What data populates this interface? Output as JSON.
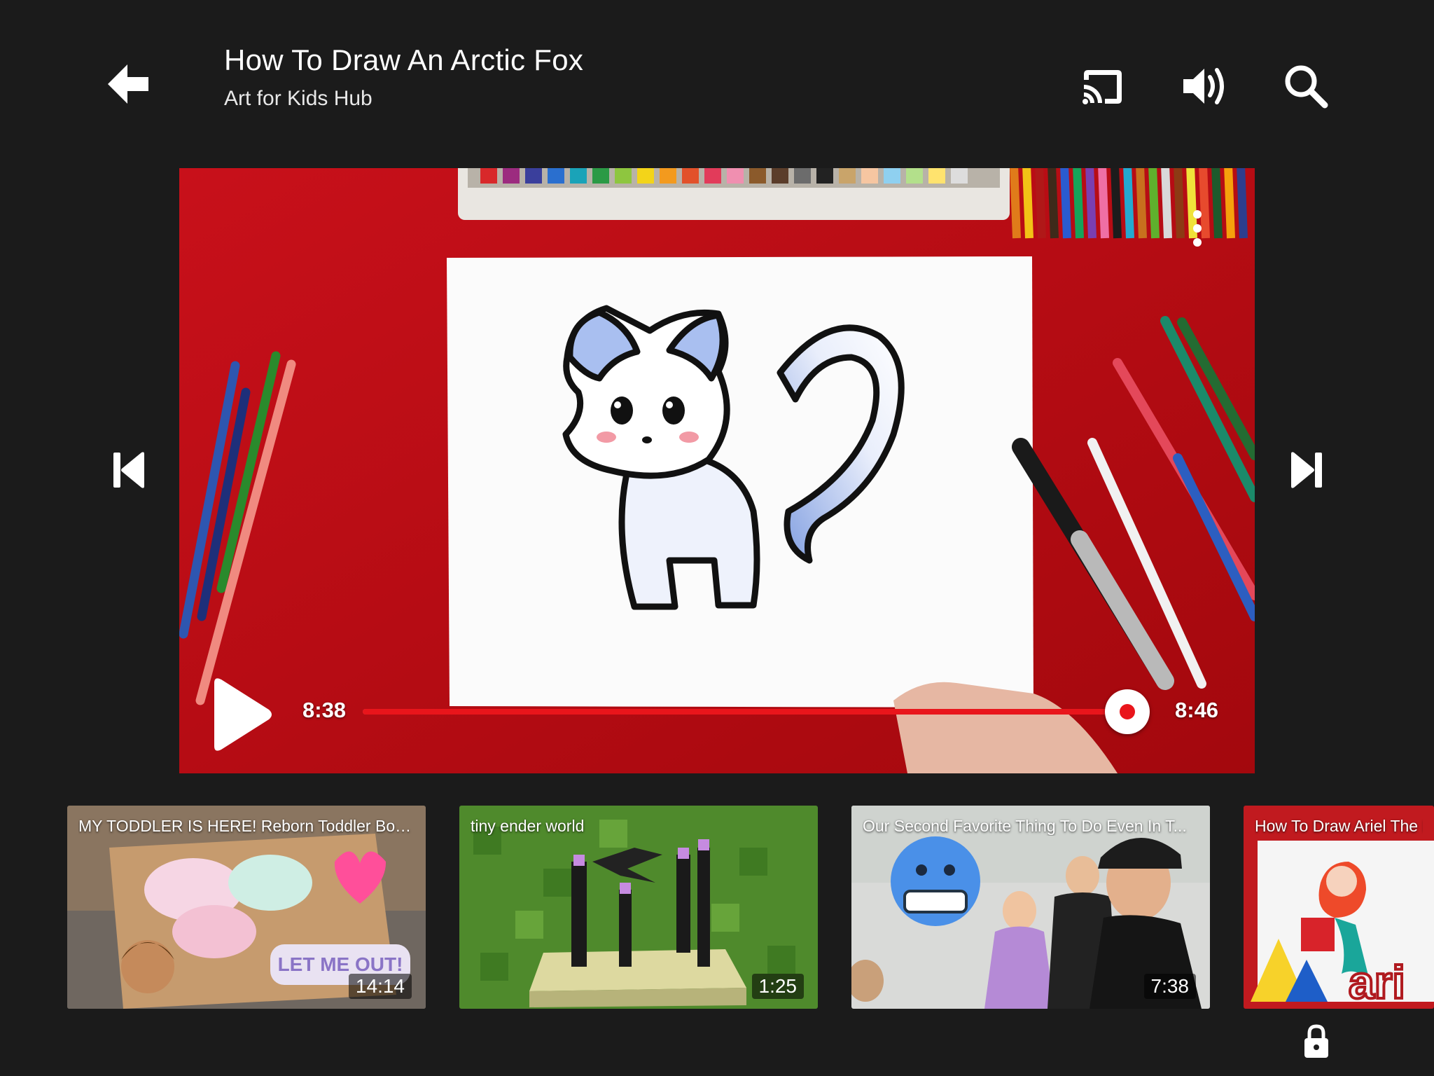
{
  "header": {
    "title": "How To Draw An Arctic Fox",
    "channel": "Art for Kids Hub",
    "icons": [
      "arrow-left-icon",
      "cast-icon",
      "volume-icon",
      "search-icon"
    ]
  },
  "player": {
    "current_time": "8:38",
    "total_time": "8:46",
    "progress_fraction": 0.984,
    "accent_color": "#e9151b"
  },
  "recommendations": [
    {
      "title": "MY TODDLER IS HERE! Reborn Toddler Box...",
      "duration": "14:14"
    },
    {
      "title": "tiny ender world",
      "duration": "1:25"
    },
    {
      "title": "Our Second Favorite Thing To Do Even In T...",
      "duration": "7:38"
    },
    {
      "title": "How To Draw Ariel The L",
      "duration": ""
    }
  ]
}
